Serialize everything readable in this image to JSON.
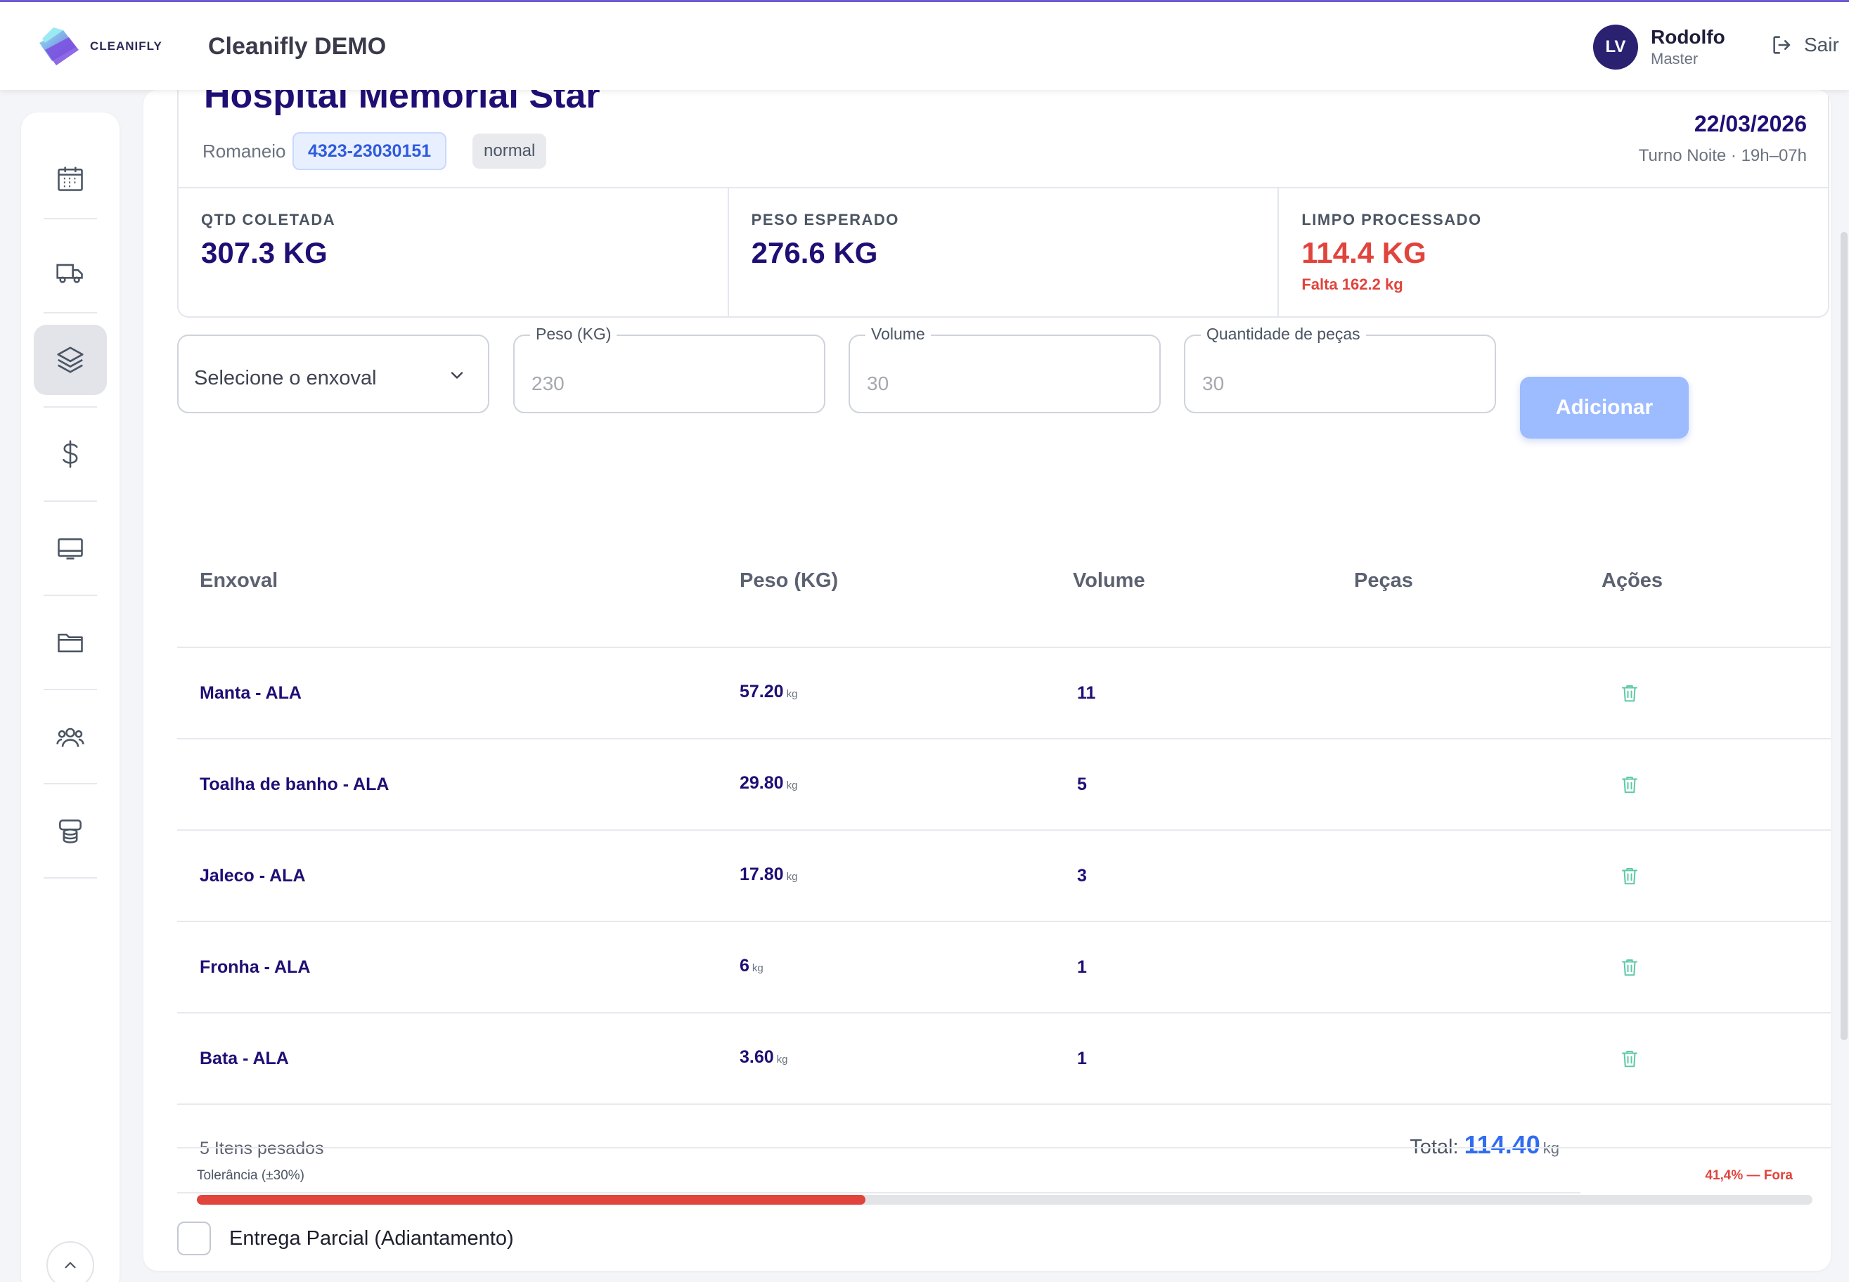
{
  "header": {
    "logo_text": "CLEANIFLY",
    "app_title": "Cleanifly DEMO",
    "user": {
      "initials": "LV",
      "name": "Rodolfo",
      "role": "Master"
    },
    "logout_label": "Sair"
  },
  "sidebar": {
    "items": [
      {
        "icon": "calendar-icon"
      },
      {
        "icon": "truck-icon"
      },
      {
        "icon": "layers-icon",
        "active": true
      },
      {
        "icon": "dollar-icon"
      },
      {
        "icon": "monitor-icon"
      },
      {
        "icon": "folder-icon"
      },
      {
        "icon": "users-icon"
      },
      {
        "icon": "database-icon"
      }
    ]
  },
  "summary": {
    "hospital_name": "Hospital Memorial Star",
    "romaneio_label": "Romaneio",
    "romaneio_code": "4323-23030151",
    "status": "normal",
    "date": "22/03/2026",
    "shift": "Turno Noite · 19h–07h",
    "stats": [
      {
        "label": "QTD COLETADA",
        "value": "307.3 KG"
      },
      {
        "label": "PESO ESPERADO",
        "value": "276.6 KG"
      },
      {
        "label": "LIMPO PROCESSADO",
        "value": "114.4 KG",
        "sub": "Falta 162.2 kg"
      }
    ]
  },
  "form": {
    "enxoval_placeholder": "Selecione o enxoval",
    "peso_label": "Peso (KG)",
    "peso_placeholder": "230",
    "volume_label": "Volume",
    "volume_placeholder": "30",
    "pecas_label": "Quantidade de peças",
    "pecas_placeholder": "30",
    "add_label": "Adicionar"
  },
  "table": {
    "headers": {
      "enxoval": "Enxoval",
      "peso": "Peso (KG)",
      "volume": "Volume",
      "pecas": "Peças",
      "acoes": "Ações"
    },
    "unit": "kg",
    "rows": [
      {
        "name": "Manta - ALA",
        "weight": "57.20",
        "volume": "11"
      },
      {
        "name": "Toalha de banho - ALA",
        "weight": "29.80",
        "volume": "5"
      },
      {
        "name": "Jaleco - ALA",
        "weight": "17.80",
        "volume": "3"
      },
      {
        "name": "Fronha - ALA",
        "weight": "6",
        "volume": "1"
      },
      {
        "name": "Bata - ALA",
        "weight": "3.60",
        "volume": "1"
      }
    ],
    "items_count": "5 Itens pesados",
    "total_label": "Total:",
    "total_value": "114.40",
    "total_unit": "kg"
  },
  "tolerance": {
    "label": "Tolerância (±30%)",
    "value_text": "41,4% — Fora",
    "progress_fraction": 0.414
  },
  "partial_delivery": {
    "label": "Entrega Parcial (Adiantamento)",
    "checked": false
  }
}
